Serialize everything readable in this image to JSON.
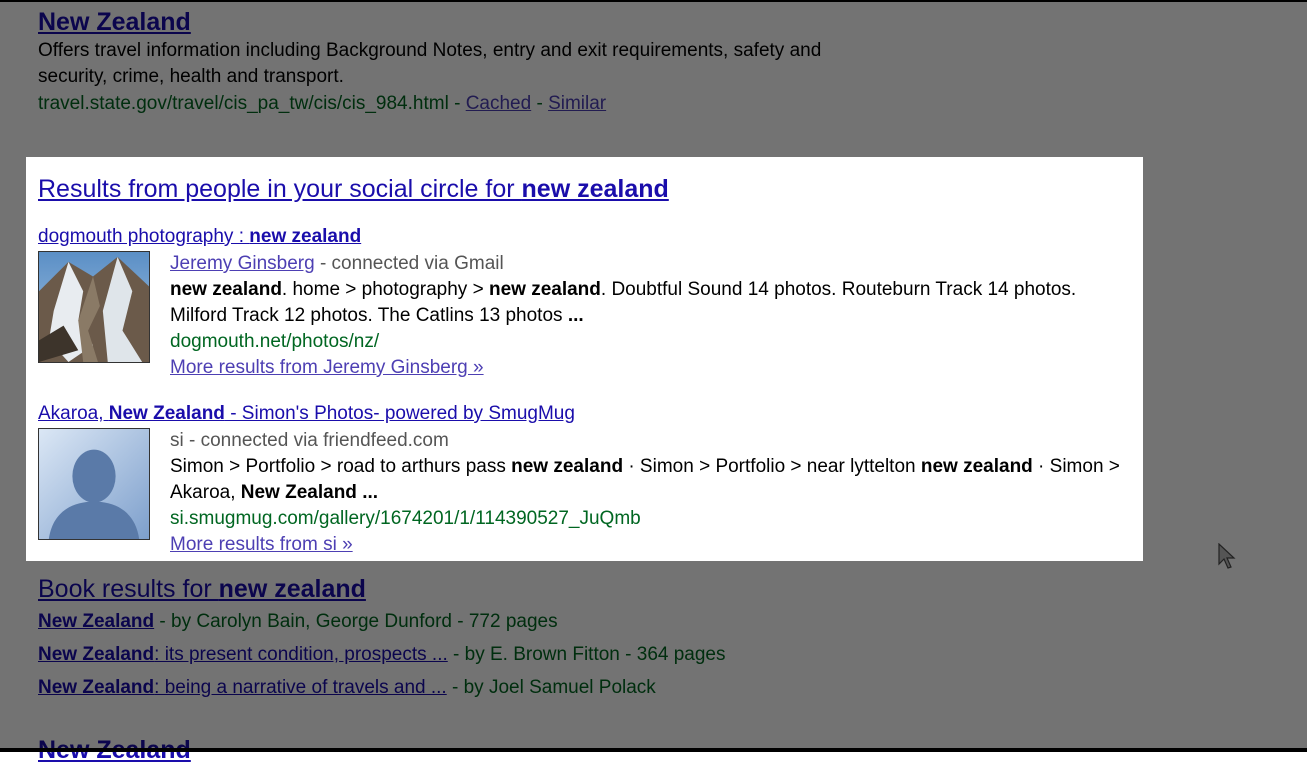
{
  "top_result": {
    "title": "New Zealand",
    "snippet_line1": "Offers travel information including Background Notes, entry and exit requirements, safety and",
    "snippet_line2": "security, crime, health and transport.",
    "url": "travel.state.gov/travel/cis_pa_tw/cis/cis_984.html",
    "sep": " - ",
    "cached": "Cached",
    "similar": "Similar"
  },
  "social": {
    "heading_prefix": "Results from people in your social circle for ",
    "heading_query": "new zealand",
    "results": [
      {
        "title_prefix": "dogmouth photography : ",
        "title_bold": "new zealand",
        "person": "Jeremy Ginsberg",
        "connection": " - connected via Gmail",
        "snippet": [
          {
            "b": "new zealand"
          },
          {
            "t": ". home > photography > "
          },
          {
            "b": "new zealand"
          },
          {
            "t": ". Doubtful Sound 14 photos. Routeburn Track 14 photos. Milford Track 12 photos. The Catlins 13 photos "
          },
          {
            "b": "..."
          }
        ],
        "url": "dogmouth.net/photos/nz/",
        "more": "More results from Jeremy Ginsberg »"
      },
      {
        "title_prefix": "Akaroa, ",
        "title_bold": "New Zealand",
        "title_suffix": " - Simon's Photos- powered by SmugMug",
        "person": "si",
        "connection": " - connected via friendfeed.com",
        "snippet": [
          {
            "t": "Simon > Portfolio > road to arthurs pass "
          },
          {
            "b": "new zealand"
          },
          {
            "t": " · Simon > Portfolio > near lyttelton "
          },
          {
            "b": "new zealand"
          },
          {
            "t": " · Simon > Akaroa, "
          },
          {
            "b": "New Zealand"
          },
          {
            "t": " "
          },
          {
            "b": "..."
          }
        ],
        "url": "si.smugmug.com/gallery/1674201/1/114390527_JuQmb",
        "more": "More results from si »"
      }
    ]
  },
  "books": {
    "heading_prefix": "Book results for ",
    "heading_query": "new zealand",
    "items": [
      {
        "bold": "New Zealand",
        "rest": "",
        "by": " - by Carolyn Bain, George Dunford - 772 pages"
      },
      {
        "bold": "New Zealand",
        "rest": ": its present condition, prospects ...",
        "by": " - by E. Brown Fitton - 364 pages"
      },
      {
        "bold": "New Zealand",
        "rest": ": being a narrative of travels and ...",
        "by": " - by Joel Samuel Polack"
      }
    ]
  },
  "bottom_cut_title": "New Zealand"
}
